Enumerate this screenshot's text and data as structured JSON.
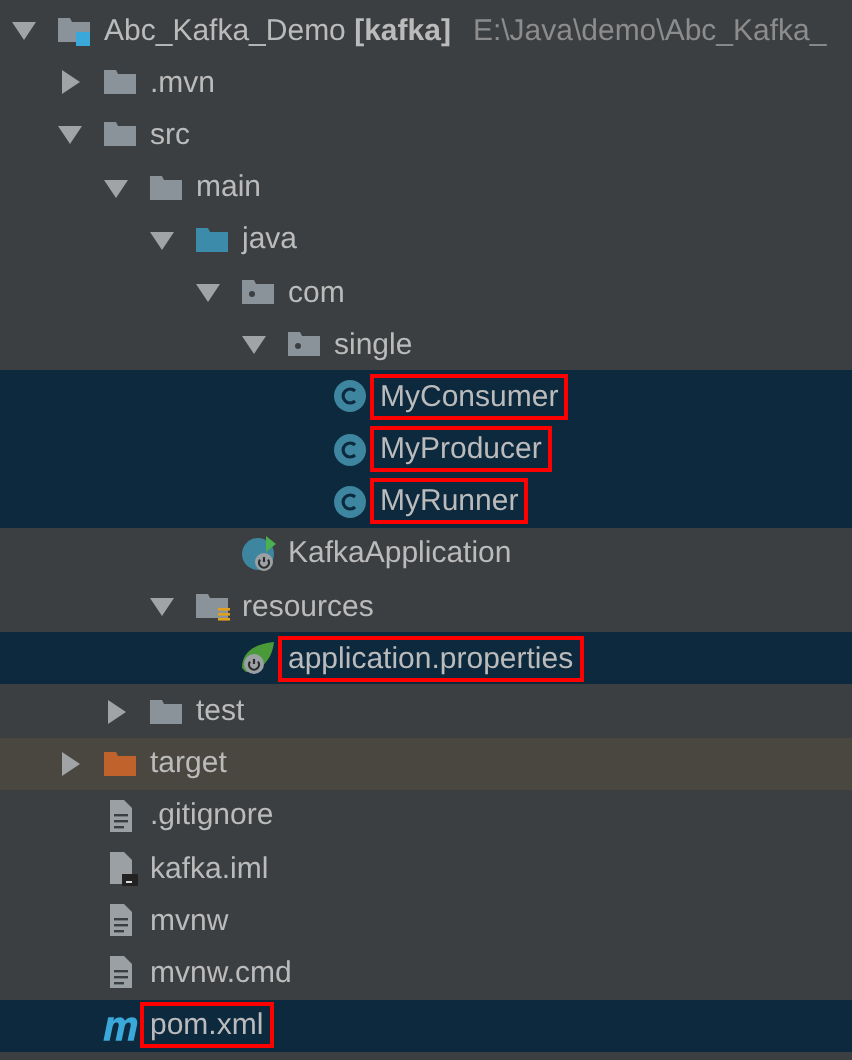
{
  "tree": [
    {
      "name": "Abc_Kafka_Demo **[kafka]**",
      "path": "E:\\Java\\demo\\Abc_Kafka_",
      "kind": "project",
      "expanded": true,
      "selected": false,
      "marked": false,
      "children": [
        {
          "name": ".mvn",
          "kind": "folder",
          "expanded": false,
          "selected": false,
          "marked": false
        },
        {
          "name": "src",
          "kind": "folder",
          "expanded": true,
          "selected": false,
          "marked": false,
          "children": [
            {
              "name": "main",
              "kind": "folder",
              "expanded": true,
              "selected": false,
              "marked": false,
              "children": [
                {
                  "name": "java",
                  "kind": "source-folder",
                  "expanded": true,
                  "selected": false,
                  "marked": false,
                  "children": [
                    {
                      "name": "com",
                      "kind": "package",
                      "expanded": true,
                      "selected": false,
                      "marked": false,
                      "children": [
                        {
                          "name": "single",
                          "kind": "package",
                          "expanded": true,
                          "selected": false,
                          "marked": false,
                          "children": [
                            {
                              "name": "MyConsumer",
                              "kind": "class",
                              "selected": true,
                              "marked": true
                            },
                            {
                              "name": "MyProducer",
                              "kind": "class",
                              "selected": true,
                              "marked": true
                            },
                            {
                              "name": "MyRunner",
                              "kind": "class",
                              "selected": true,
                              "marked": true
                            }
                          ]
                        }
                      ]
                    },
                    {
                      "name": "KafkaApplication",
                      "kind": "spring-class",
                      "selected": false,
                      "marked": false
                    }
                  ]
                },
                {
                  "name": "resources",
                  "kind": "resources-folder",
                  "expanded": true,
                  "selected": false,
                  "marked": false,
                  "children": [
                    {
                      "name": "application.properties",
                      "kind": "spring-config",
                      "selected": true,
                      "marked": true
                    }
                  ]
                }
              ]
            },
            {
              "name": "test",
              "kind": "folder",
              "expanded": false,
              "selected": false,
              "marked": false
            }
          ]
        },
        {
          "name": "target",
          "kind": "excluded-folder",
          "expanded": false,
          "selected": false,
          "marked": false
        },
        {
          "name": ".gitignore",
          "kind": "text-file",
          "selected": false,
          "marked": false
        },
        {
          "name": "kafka.iml",
          "kind": "module-file",
          "selected": false,
          "marked": false
        },
        {
          "name": "mvnw",
          "kind": "text-file",
          "selected": false,
          "marked": false
        },
        {
          "name": "mvnw.cmd",
          "kind": "text-file",
          "selected": false,
          "marked": false
        },
        {
          "name": "pom.xml",
          "kind": "maven-file",
          "selected": true,
          "marked": true
        }
      ]
    }
  ]
}
